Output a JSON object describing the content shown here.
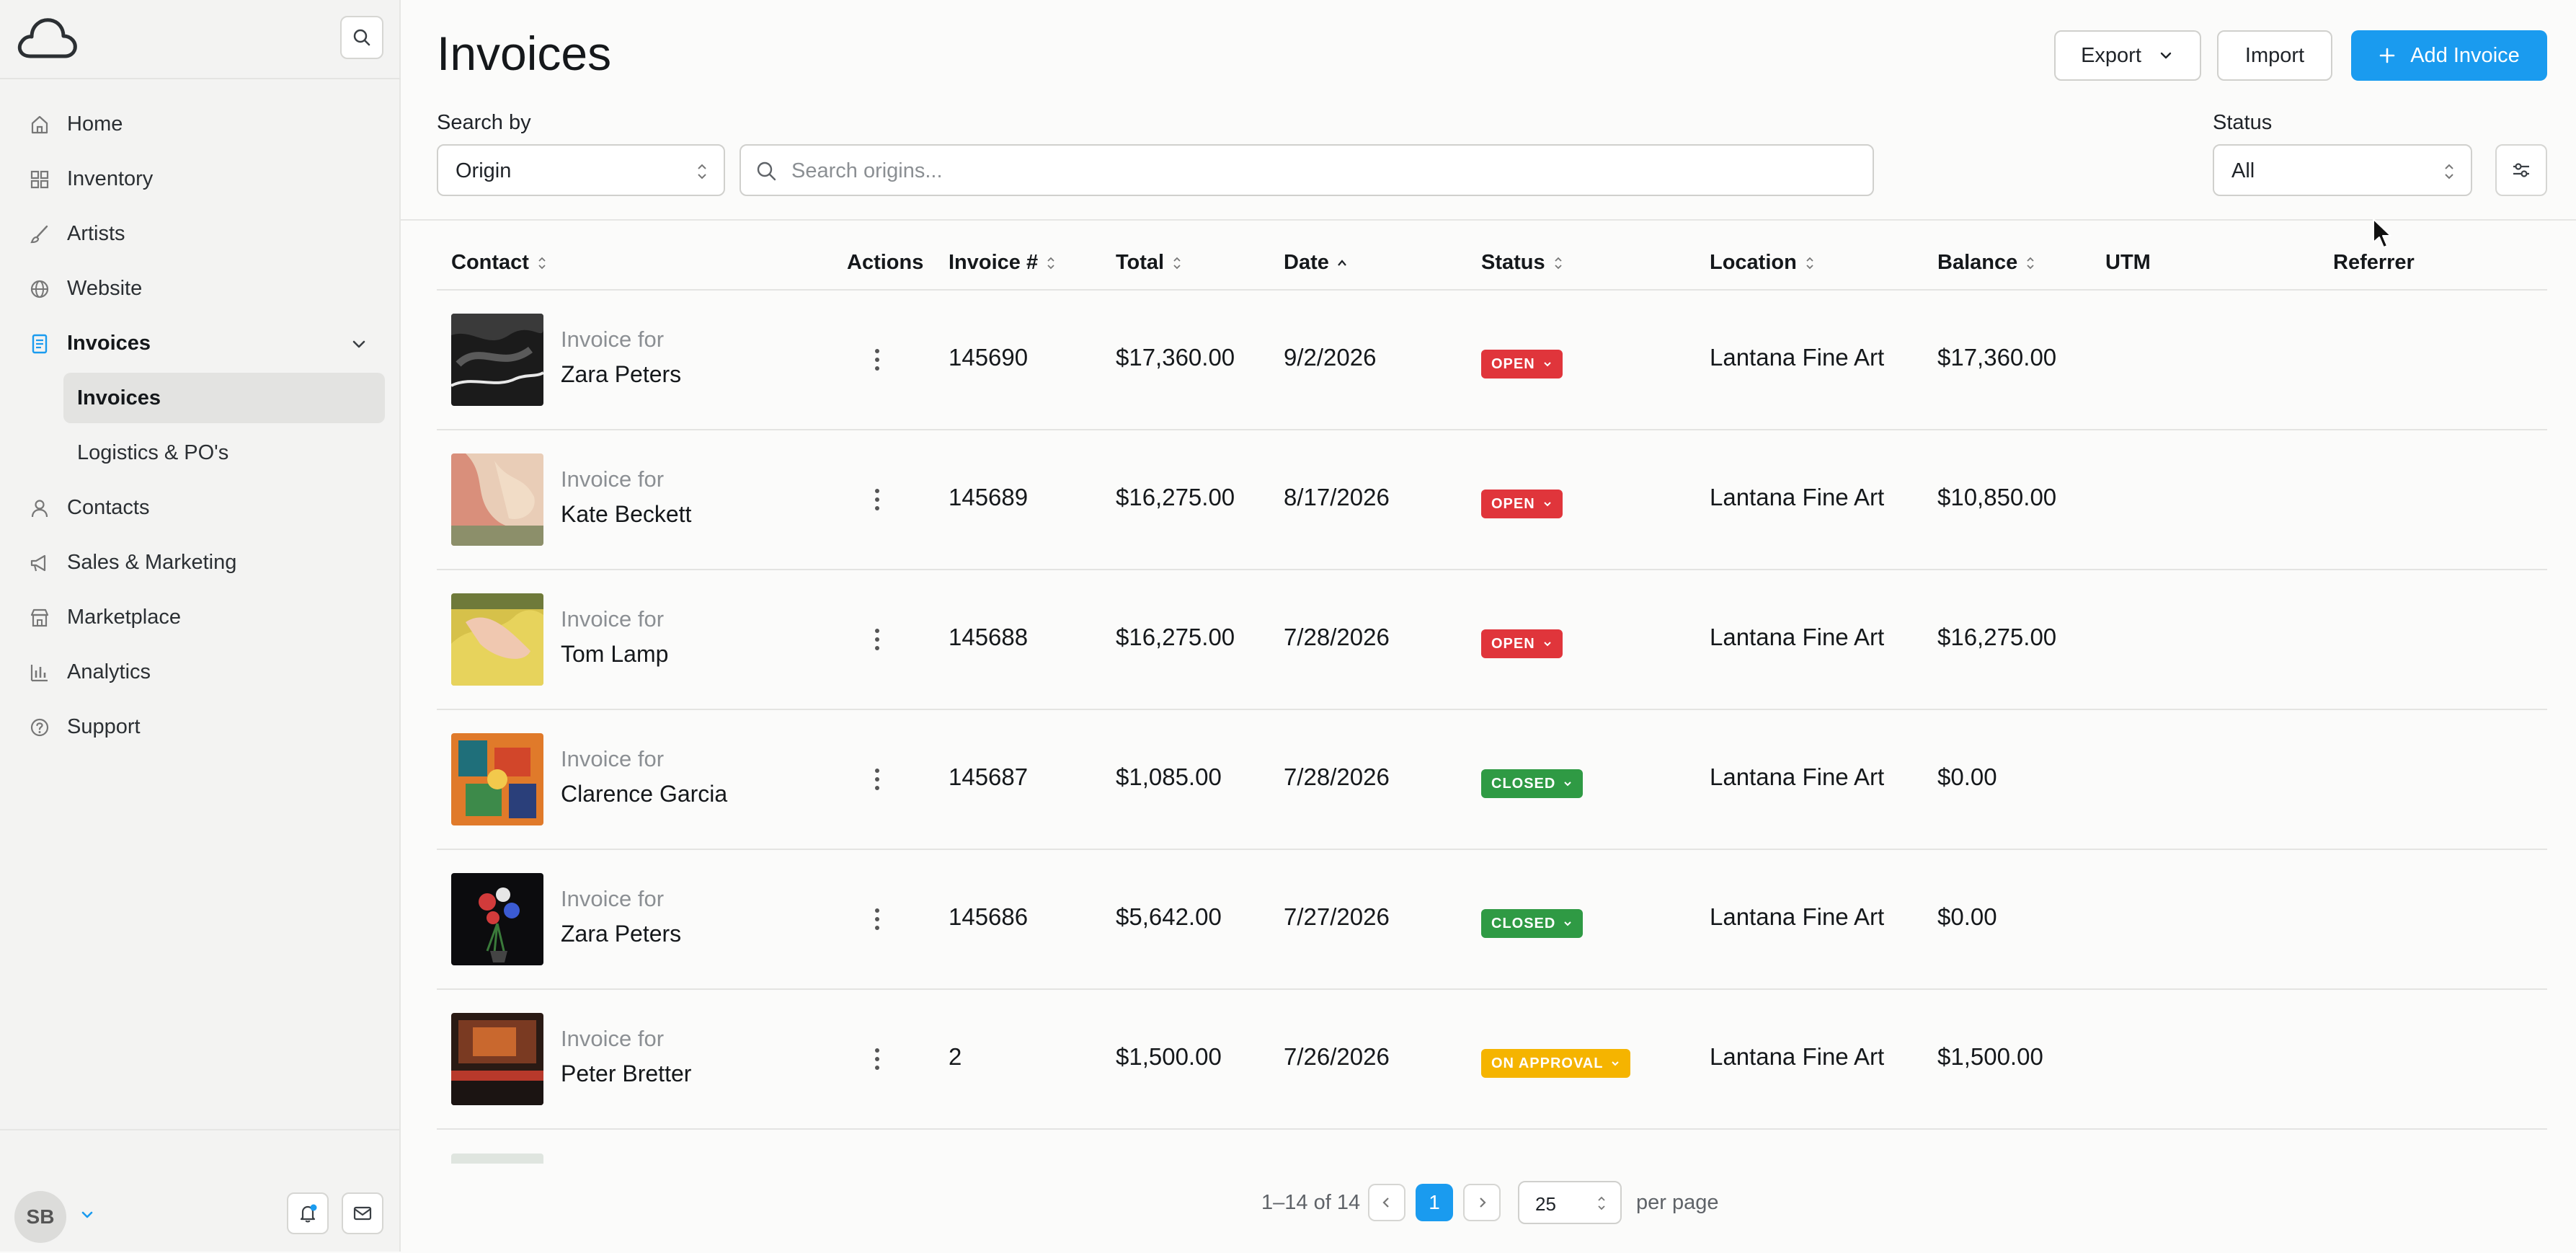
{
  "sidebar": {
    "nav": [
      {
        "label": "Home",
        "icon": "home-icon"
      },
      {
        "label": "Inventory",
        "icon": "grid-icon"
      },
      {
        "label": "Artists",
        "icon": "brush-icon"
      },
      {
        "label": "Website",
        "icon": "globe-icon"
      },
      {
        "label": "Invoices",
        "icon": "document-icon"
      },
      {
        "label": "Contacts",
        "icon": "person-icon"
      },
      {
        "label": "Sales & Marketing",
        "icon": "megaphone-icon"
      },
      {
        "label": "Marketplace",
        "icon": "store-icon"
      },
      {
        "label": "Analytics",
        "icon": "bar-chart-icon"
      },
      {
        "label": "Support",
        "icon": "help-circle-icon"
      }
    ],
    "subnav": [
      {
        "label": "Invoices",
        "active": true
      },
      {
        "label": "Logistics & PO's",
        "active": false
      }
    ],
    "user_initials": "SB"
  },
  "header": {
    "title": "Invoices",
    "export_label": "Export",
    "import_label": "Import",
    "add_label": "Add Invoice"
  },
  "filters": {
    "search_by_label": "Search by",
    "search_by_value": "Origin",
    "search_placeholder": "Search origins...",
    "status_label": "Status",
    "status_value": "All"
  },
  "table": {
    "columns": [
      "Contact",
      "Actions",
      "Invoice #",
      "Total",
      "Date",
      "Status",
      "Location",
      "Balance",
      "UTM",
      "Referrer"
    ],
    "invoice_for_label": "Invoice for",
    "rows": [
      {
        "contact": "Zara Peters",
        "invoice": "145690",
        "total": "$17,360.00",
        "date": "9/2/2026",
        "status": "OPEN",
        "location": "Lantana Fine Art",
        "balance": "$17,360.00"
      },
      {
        "contact": "Kate Beckett",
        "invoice": "145689",
        "total": "$16,275.00",
        "date": "8/17/2026",
        "status": "OPEN",
        "location": "Lantana Fine Art",
        "balance": "$10,850.00"
      },
      {
        "contact": "Tom Lamp",
        "invoice": "145688",
        "total": "$16,275.00",
        "date": "7/28/2026",
        "status": "OPEN",
        "location": "Lantana Fine Art",
        "balance": "$16,275.00"
      },
      {
        "contact": "Clarence Garcia",
        "invoice": "145687",
        "total": "$1,085.00",
        "date": "7/28/2026",
        "status": "CLOSED",
        "location": "Lantana Fine Art",
        "balance": "$0.00"
      },
      {
        "contact": "Zara Peters",
        "invoice": "145686",
        "total": "$5,642.00",
        "date": "7/27/2026",
        "status": "CLOSED",
        "location": "Lantana Fine Art",
        "balance": "$0.00"
      },
      {
        "contact": "Peter Bretter",
        "invoice": "2",
        "total": "$1,500.00",
        "date": "7/26/2026",
        "status": "ON APPROVAL",
        "location": "Lantana Fine Art",
        "balance": "$1,500.00"
      }
    ]
  },
  "pagination": {
    "range": "1–14 of 14",
    "current_page": "1",
    "per_page_value": "25",
    "per_page_label": "per page"
  },
  "colors": {
    "accent": "#1a9bef",
    "open": "#e0353b",
    "closed": "#2f9a44",
    "approval": "#f5b400"
  }
}
